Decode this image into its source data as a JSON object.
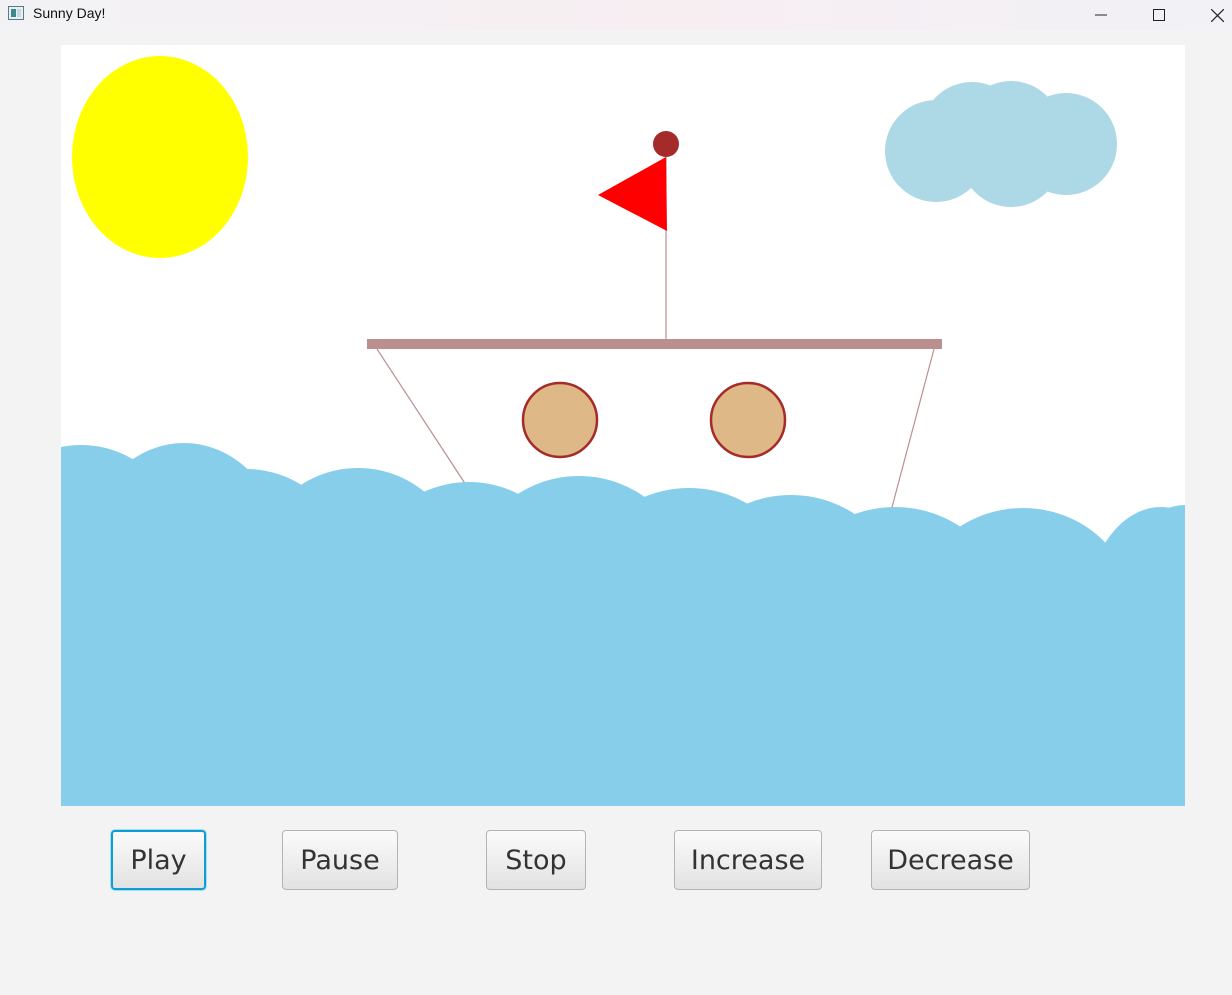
{
  "window": {
    "title": "Sunny Day!",
    "controls": [
      "minimize",
      "maximize",
      "close"
    ]
  },
  "scene": {
    "icons": [
      "sun",
      "cloud",
      "flag",
      "boat",
      "porthole",
      "waves"
    ],
    "colors": {
      "sky": "#ffffff",
      "sun": "#ffff00",
      "cloud": "#add8e6",
      "water": "#87ceeb",
      "flag": "#ff0000",
      "flag_ball": "#a52a2a",
      "deck": "#bc8f8f",
      "porthole_fill": "#deb887",
      "porthole_stroke": "#a52a2a"
    }
  },
  "controls": {
    "play_label": "Play",
    "pause_label": "Pause",
    "stop_label": "Stop",
    "increase_label": "Increase",
    "decrease_label": "Decrease",
    "focused": "Play"
  }
}
